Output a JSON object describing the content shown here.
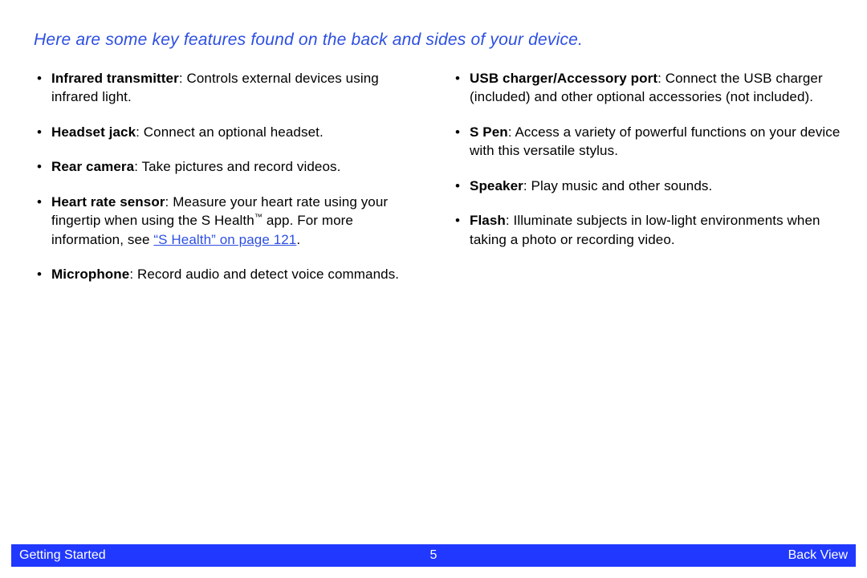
{
  "heading": "Here are some key features found on the back and sides of your device.",
  "left_items": [
    {
      "term": "Infrared transmitter",
      "desc": ": Controls external devices using infrared light."
    },
    {
      "term": "Headset jack",
      "desc": ": Connect an optional headset."
    },
    {
      "term": "Rear camera",
      "desc": ": Take pictures and record videos."
    },
    {
      "term": "Heart rate sensor",
      "desc_pre": ": Measure your heart rate using your fingertip when using the S Health",
      "tm": "™",
      "desc_mid": " app. For more information, see ",
      "link": "“S Health” on page 121",
      "desc_post": "."
    },
    {
      "term": "Microphone",
      "desc": ": Record audio and detect voice commands."
    }
  ],
  "right_items": [
    {
      "term": "USB charger/Accessory port",
      "desc": ": Connect the USB charger (included) and other optional accessories (not included)."
    },
    {
      "term": "S Pen",
      "desc": ": Access a variety of powerful functions on your device with this versatile stylus."
    },
    {
      "term": "Speaker",
      "desc": ": Play music and other sounds."
    },
    {
      "term": "Flash",
      "desc": ": Illuminate subjects in low-light environments when taking a photo or recording video."
    }
  ],
  "footer": {
    "left": "Getting Started",
    "center": "5",
    "right": "Back View"
  }
}
